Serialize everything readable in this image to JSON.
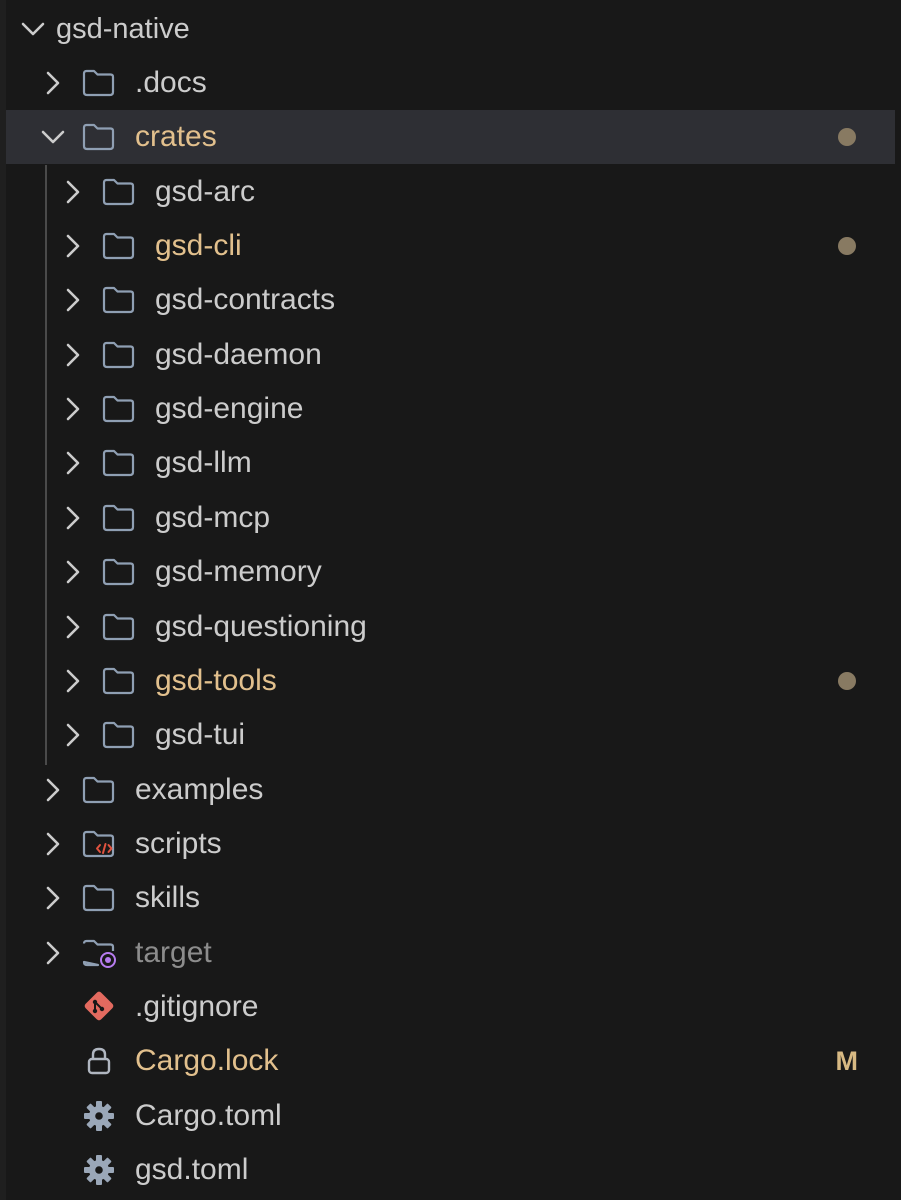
{
  "explorer": {
    "root": {
      "label": "gsd-native",
      "expanded": true
    },
    "items": [
      {
        "label": ".docs",
        "kind": "folder",
        "depth": 1,
        "expanded": false,
        "status": ""
      },
      {
        "label": "crates",
        "kind": "folder",
        "depth": 1,
        "expanded": true,
        "status": "modified",
        "selected": true
      },
      {
        "label": "gsd-arc",
        "kind": "folder",
        "depth": 2,
        "expanded": false,
        "status": ""
      },
      {
        "label": "gsd-cli",
        "kind": "folder",
        "depth": 2,
        "expanded": false,
        "status": "modified"
      },
      {
        "label": "gsd-contracts",
        "kind": "folder",
        "depth": 2,
        "expanded": false,
        "status": ""
      },
      {
        "label": "gsd-daemon",
        "kind": "folder",
        "depth": 2,
        "expanded": false,
        "status": ""
      },
      {
        "label": "gsd-engine",
        "kind": "folder",
        "depth": 2,
        "expanded": false,
        "status": ""
      },
      {
        "label": "gsd-llm",
        "kind": "folder",
        "depth": 2,
        "expanded": false,
        "status": ""
      },
      {
        "label": "gsd-mcp",
        "kind": "folder",
        "depth": 2,
        "expanded": false,
        "status": ""
      },
      {
        "label": "gsd-memory",
        "kind": "folder",
        "depth": 2,
        "expanded": false,
        "status": ""
      },
      {
        "label": "gsd-questioning",
        "kind": "folder",
        "depth": 2,
        "expanded": false,
        "status": ""
      },
      {
        "label": "gsd-tools",
        "kind": "folder",
        "depth": 2,
        "expanded": false,
        "status": "modified"
      },
      {
        "label": "gsd-tui",
        "kind": "folder",
        "depth": 2,
        "expanded": false,
        "status": ""
      },
      {
        "label": "examples",
        "kind": "folder",
        "depth": 1,
        "expanded": false,
        "status": ""
      },
      {
        "label": "scripts",
        "kind": "folder-scripts",
        "depth": 1,
        "expanded": false,
        "status": ""
      },
      {
        "label": "skills",
        "kind": "folder",
        "depth": 1,
        "expanded": false,
        "status": ""
      },
      {
        "label": "target",
        "kind": "folder-target",
        "depth": 1,
        "expanded": false,
        "status": "ignored"
      },
      {
        "label": ".gitignore",
        "kind": "git-file",
        "depth": 1,
        "status": ""
      },
      {
        "label": "Cargo.lock",
        "kind": "lock-file",
        "depth": 1,
        "status": "modified",
        "badge": "M"
      },
      {
        "label": "Cargo.toml",
        "kind": "gear-file",
        "depth": 1,
        "status": ""
      },
      {
        "label": "gsd.toml",
        "kind": "gear-file",
        "depth": 1,
        "status": ""
      }
    ]
  },
  "icons": {
    "folder": "folder-icon",
    "folder-scripts": "folder-scripts-icon",
    "folder-target": "folder-target-icon",
    "git-file": "git-icon",
    "lock-file": "lock-icon",
    "gear-file": "gear-icon",
    "chevron-right": "chevron-right-icon",
    "chevron-down": "chevron-down-icon"
  },
  "colors": {
    "background": "#181818",
    "selection": "#2e2f34",
    "text": "#cccccc",
    "modified_text": "#e2c08d",
    "ignored_text": "#8c8c8c",
    "modified_dot": "#887a62",
    "badge": "#d7b983",
    "folder_icon": "#8f9fb3",
    "script_accent": "#e0523f",
    "target_accent": "#b77cf0",
    "git_icon": "#e36a5f"
  }
}
